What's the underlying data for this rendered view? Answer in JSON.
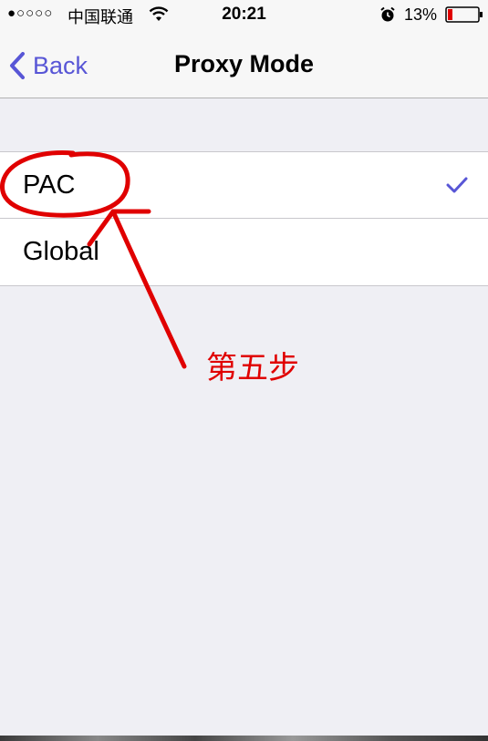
{
  "status_bar": {
    "signal": "●○○○○",
    "carrier": "中国联通",
    "time": "20:21",
    "battery_percent": "13%",
    "icons": [
      "wifi-icon",
      "alarm-icon",
      "battery-icon"
    ]
  },
  "nav": {
    "back_label": "Back",
    "title": "Proxy Mode",
    "accent_color": "#5856d6"
  },
  "list": {
    "items": [
      {
        "label": "PAC",
        "selected": true
      },
      {
        "label": "Global",
        "selected": false
      }
    ]
  },
  "annotation": {
    "text": "第五步",
    "color": "#e00000"
  }
}
